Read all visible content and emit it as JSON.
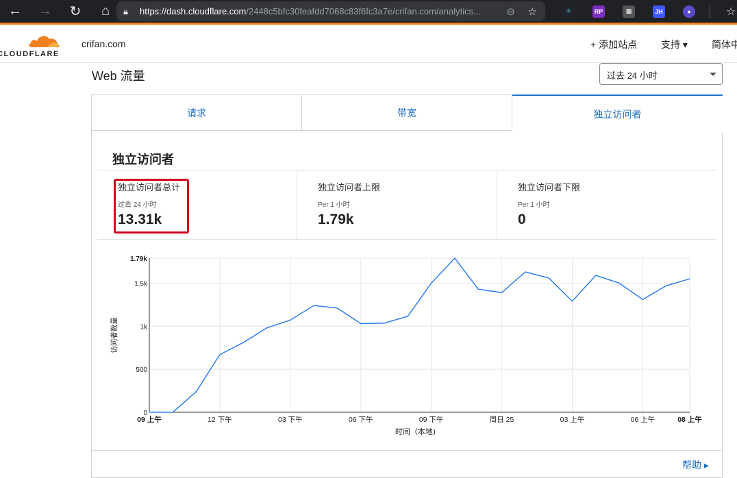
{
  "browser": {
    "url_host": "https://dash.cloudflare.com",
    "url_rest": "/2448c5bfc30feafdd7068c83f6fc3a7e/crifan.com/analytics..."
  },
  "header": {
    "logo_text": "CLOUDFLARE",
    "domain": "crifan.com",
    "add_site": "+ 添加站点",
    "support": "支持 ▾",
    "language": "简体中"
  },
  "page": {
    "title": "Web 流量",
    "time_range": "过去 24 小时"
  },
  "tabs": [
    {
      "label": "请求"
    },
    {
      "label": "带宽"
    },
    {
      "label": "独立访问者"
    }
  ],
  "section_title": "独立访问者",
  "stats": [
    {
      "label": "独立访问者总计",
      "sub": "过去 24 小时",
      "value": "13.31k"
    },
    {
      "label": "独立访问者上限",
      "sub": "Per 1 小时",
      "value": "1.79k"
    },
    {
      "label": "独立访问者下限",
      "sub": "Per 1 小时",
      "value": "0"
    }
  ],
  "help": "帮助 ▸",
  "chart_data": {
    "type": "line",
    "ylabel": "访问者数量",
    "xlabel": "时间（本地)",
    "ylim": [
      0,
      1790
    ],
    "y_ticks": [
      {
        "v": 0,
        "label": "0",
        "bold": false
      },
      {
        "v": 500,
        "label": "500",
        "bold": false
      },
      {
        "v": 1000,
        "label": "1k",
        "bold": false
      },
      {
        "v": 1500,
        "label": "1.5k",
        "bold": false
      },
      {
        "v": 1790,
        "label": "1.79k",
        "bold": true
      }
    ],
    "x_ticks": [
      {
        "i": 0,
        "label": "09 上午",
        "bold": true
      },
      {
        "i": 3,
        "label": "12 下午",
        "bold": false
      },
      {
        "i": 6,
        "label": "03 下午",
        "bold": false
      },
      {
        "i": 9,
        "label": "06 下午",
        "bold": false
      },
      {
        "i": 12,
        "label": "09 下午",
        "bold": false
      },
      {
        "i": 15,
        "label": "周日 25",
        "bold": false
      },
      {
        "i": 18,
        "label": "03 上午",
        "bold": false
      },
      {
        "i": 21,
        "label": "06 上午",
        "bold": false
      },
      {
        "i": 23,
        "label": "08 上午",
        "bold": true
      }
    ],
    "series": [
      {
        "values": [
          0,
          0,
          240,
          670,
          810,
          980,
          1070,
          1240,
          1210,
          1030,
          1035,
          1115,
          1500,
          1790,
          1430,
          1390,
          1630,
          1560,
          1290,
          1590,
          1500,
          1310,
          1470,
          1550
        ],
        "color": "#2f80ed"
      }
    ]
  }
}
